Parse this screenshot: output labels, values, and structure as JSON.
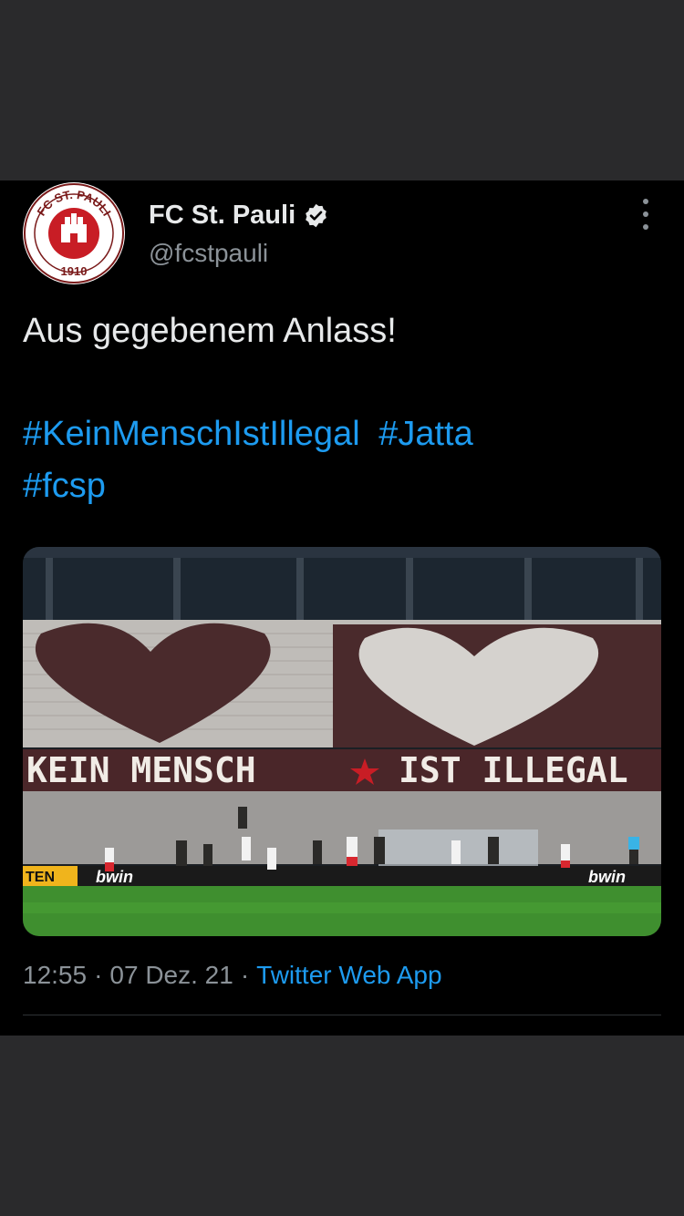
{
  "tweet": {
    "author": {
      "name": "FC St. Pauli",
      "handle": "@fcstpauli",
      "verified": true,
      "avatar_text_top": "FC ST. PAULI",
      "avatar_text_bottom": "1910"
    },
    "text": "Aus gegebenem Anlass!",
    "hashtags": [
      "#KeinMenschIstIllegal",
      "#Jatta",
      "#fcsp"
    ],
    "media": {
      "banner_left": "KEIN MENSCH",
      "banner_right": "IST ILLEGAL",
      "ad_text": "bwin",
      "ad_left": "TEN"
    },
    "time": "12:55",
    "date": "07 Dez. 21",
    "source": "Twitter Web App",
    "separator": "·"
  },
  "colors": {
    "accent": "#1d9bf0",
    "background": "#000000",
    "frame": "#2a2a2c",
    "muted": "#8b9298"
  }
}
